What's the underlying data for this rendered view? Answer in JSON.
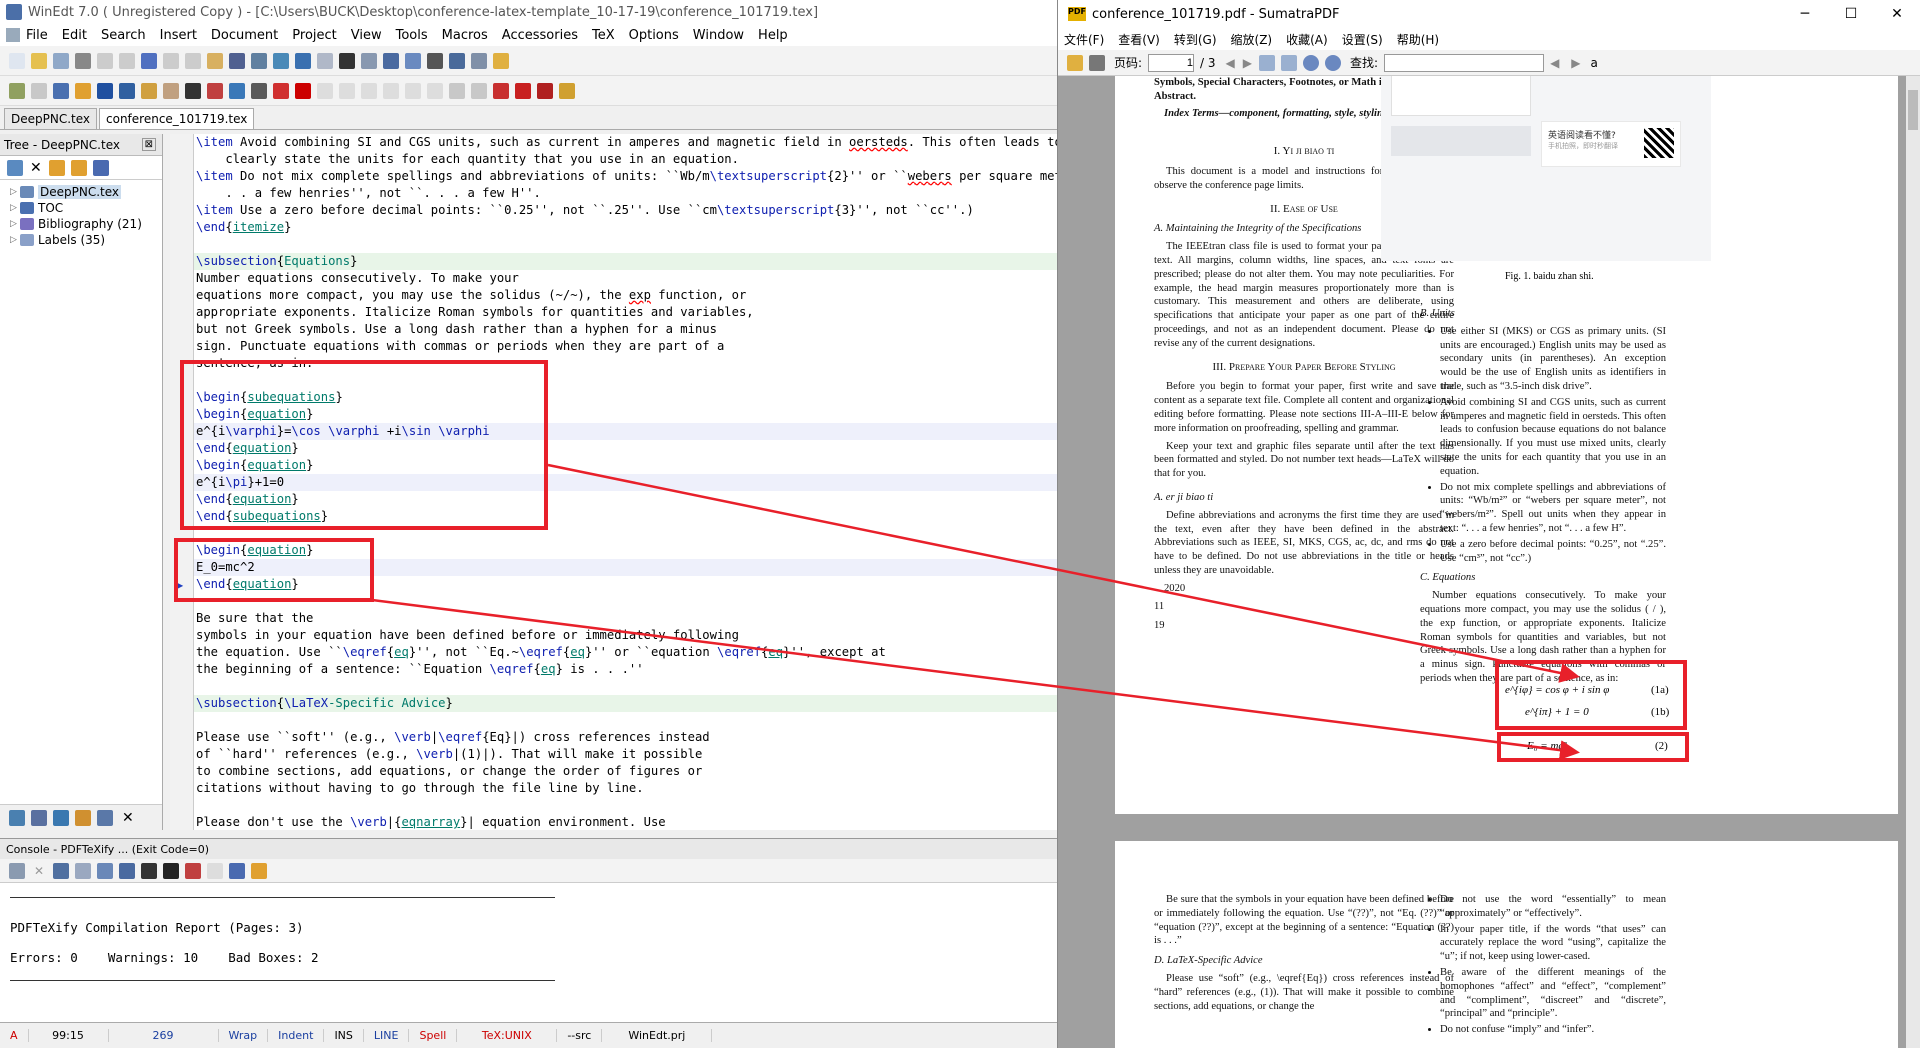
{
  "winedt": {
    "title": "WinEdt 7.0  ( Unregistered  Copy )  - [C:\\Users\\BUCK\\Desktop\\conference-latex-template_10-17-19\\conference_101719.tex]",
    "menu": [
      "File",
      "Edit",
      "Search",
      "Insert",
      "Document",
      "Project",
      "View",
      "Tools",
      "Macros",
      "Accessories",
      "TeX",
      "Options",
      "Window",
      "Help"
    ],
    "tabs": [
      "DeepPNC.tex",
      "conference_101719.tex"
    ],
    "tree": {
      "header": "Tree - DeepPNC.tex",
      "items": [
        {
          "label": "DeepPNC.tex"
        },
        {
          "label": "TOC"
        },
        {
          "label": "Bibliography  (21)"
        },
        {
          "label": "Labels  (35)"
        }
      ]
    },
    "console": {
      "header": "Console - PDFTeXify ... (Exit Code=0)",
      "report": "PDFTeXify Compilation Report (Pages: 3)",
      "stats": "Errors: 0    Warnings: 10    Bad Boxes: 2"
    },
    "status": {
      "a": "A",
      "pos": "99:15",
      "num": "269",
      "wrap": "Wrap",
      "indent": "Indent",
      "ins": "INS",
      "line": "LINE",
      "spell": "Spell",
      "tex": "TeX:UNIX",
      "src": "--src",
      "prj": "WinEdt.prj"
    }
  },
  "sumatra": {
    "title": "conference_101719.pdf - SumatraPDF",
    "menu": [
      "文件(F)",
      "查看(V)",
      "转到(G)",
      "缩放(Z)",
      "收藏(A)",
      "设置(S)",
      "帮助(H)"
    ],
    "page_label": "页码:",
    "page_value": "1",
    "page_total": "/ 3",
    "find_label": "查找:",
    "page1": {
      "top1": "your paper [title, text, heads, etc.]. *CRITICAL: Do Not Use Symbols, Special Characters, Footnotes, or Math in Paper Title or Abstract.",
      "index": "Index Terms—component, formatting, style, styling, insert",
      "h1": "I. Yi ji biao ti",
      "p1": "This document is a model and instructions for LaTeX. Please observe the conference page limits.",
      "h2": "II. Ease of Use",
      "s1": "A. Maintaining the Integrity of the Specifications",
      "p2": "The IEEEtran class file is used to format your paper and style the text. All margins, column widths, line spaces, and text fonts are prescribed; please do not alter them. You may note peculiarities. For example, the head margin measures proportionately more than is customary. This measurement and others are deliberate, using specifications that anticipate your paper as one part of the entire proceedings, and not as an independent document. Please do not revise any of the current designations.",
      "h3": "III. Prepare Your Paper Before Styling",
      "p3": "Before you begin to format your paper, first write and save the content as a separate text file. Complete all content and organizational editing before formatting. Please note sections III-A–III-E below for more information on proofreading, spelling and grammar.",
      "p4": "Keep your text and graphic files separate until after the text has been formatted and styled. Do not number text heads—LaTeX will do that for you.",
      "s2": "A. er ji biao ti",
      "p5": "Define abbreviations and acronyms the first time they are used in the text, even after they have been defined in the abstract. Abbreviations such as IEEE, SI, MKS, CGS, ac, dc, and rms do not have to be defined. Do not use abbreviations in the title or heads unless they are unavoidable.",
      "y2020": "2020",
      "n11": "11",
      "n19": "19",
      "fig_inner1": "英语阅读看不懂?",
      "fig_inner2": "手机拍照，即时秒翻译",
      "figcap": "Fig. 1.  baidu zhan shi.",
      "s3": "B. Units",
      "units": [
        "Use either SI (MKS) or CGS as primary units. (SI units are encouraged.) English units may be used as secondary units (in parentheses). An exception would be the use of English units as identifiers in trade, such as “3.5-inch disk drive”.",
        "Avoid combining SI and CGS units, such as current in amperes and magnetic field in oersteds. This often leads to confusion because equations do not balance dimensionally. If you must use mixed units, clearly state the units for each quantity that you use in an equation.",
        "Do not mix complete spellings and abbreviations of units: “Wb/m²” or “webers per square meter”, not “webers/m²”. Spell out units when they appear in text: “. . . a few henries”, not “. . . a few H”.",
        "Use a zero before decimal points: “0.25”, not “.25”. Use “cm³”, not “cc”.)"
      ],
      "s4": "C. Equations",
      "p6": "Number equations consecutively. To make your equations more compact, you may use the solidus ( / ), the exp function, or appropriate exponents. Italicize Roman symbols for quantities and variables, but not Greek symbols. Use a long dash rather than a hyphen for a minus sign. Punctuate equations with commas or periods when they are part of a sentence, as in:",
      "eq1a": "e^{iφ} = cos φ + i sin φ",
      "eq1a_no": "(1a)",
      "eq1b": "e^{iπ} + 1 = 0",
      "eq1b_no": "(1b)",
      "eq2": "E₀ = mc²",
      "eq2_no": "(2)"
    },
    "page2": {
      "p1": "Be sure that the symbols in your equation have been defined before or immediately following the equation. Use “(??)”, not “Eq. (??)” or “equation (??)”, except at the beginning of a sentence: “Equation (??) is . . .”",
      "s1": "D. LaTeX-Specific Advice",
      "p2": "Please use “soft” (e.g., \\eqref{Eq}) cross references instead of “hard” references (e.g., (1)). That will make it possible to combine sections, add equations, or change the",
      "list": [
        "Do not use the word “essentially” to mean “approximately” or “effectively”.",
        "In your paper title, if the words “that uses” can accurately replace the word “using”, capitalize the “u”; if not, keep using lower-cased.",
        "Be aware of the different meanings of the homophones “affect” and “effect”, “complement” and “compliment”, “discreet” and “discrete”, “principal” and “principle”.",
        "Do not confuse “imply” and “infer”."
      ]
    }
  }
}
